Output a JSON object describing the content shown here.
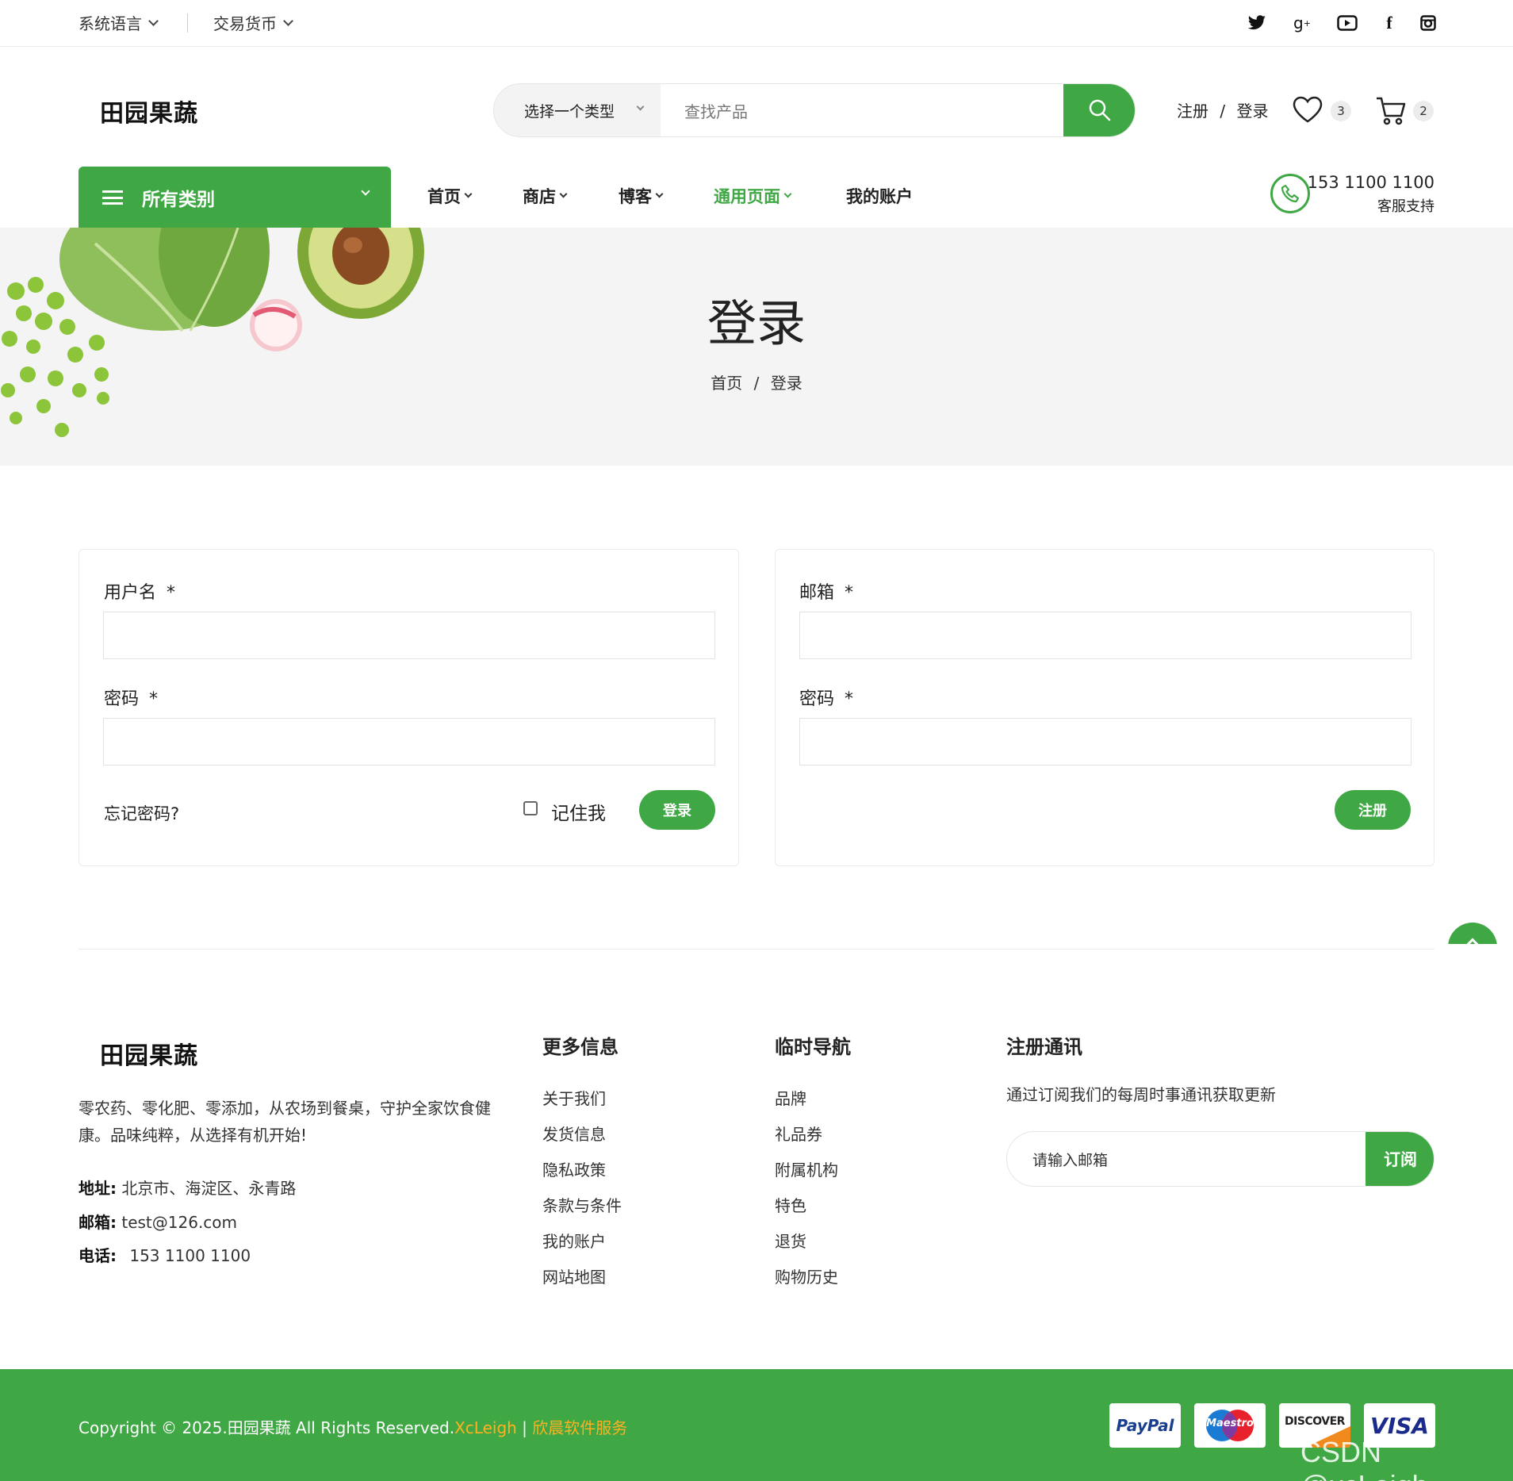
{
  "topbar": {
    "language_label": "系统语言",
    "currency_label": "交易货币",
    "social_icons": [
      "twitter-icon",
      "google-plus-icon",
      "youtube-icon",
      "facebook-icon",
      "instagram-icon"
    ]
  },
  "header": {
    "logo": "田园果蔬",
    "search_category": "选择一个类型",
    "search_placeholder": "查找产品",
    "register": "注册",
    "separator": "/",
    "login": "登录",
    "wishlist_count": "3",
    "cart_count": "2"
  },
  "nav": {
    "all_categories": "所有类别",
    "items": [
      {
        "label": "首页",
        "dropdown": true
      },
      {
        "label": "商店",
        "dropdown": true
      },
      {
        "label": "博客",
        "dropdown": true
      },
      {
        "label": "通用页面",
        "dropdown": true,
        "active": true
      },
      {
        "label": "我的账户",
        "dropdown": false
      }
    ],
    "phone": "153 1100 1100",
    "support_label": "客服支持"
  },
  "banner": {
    "title": "登录",
    "breadcrumb_home": "首页",
    "breadcrumb_sep": "/",
    "breadcrumb_current": "登录"
  },
  "login_form": {
    "username_label": "用户名",
    "password_label": "密码",
    "required_mark": "*",
    "forgot": "忘记密码?",
    "remember": "记住我",
    "submit": "登录"
  },
  "register_form": {
    "email_label": "邮箱",
    "password_label": "密码",
    "required_mark": "*",
    "submit": "注册"
  },
  "footer": {
    "logo": "田园果蔬",
    "about": "零农药、零化肥、零添加，从农场到餐桌，守护全家饮食健康。品味纯粹，从选择有机开始!",
    "address_label": "地址:",
    "address": "北京市、海淀区、永青路",
    "email_label": "邮箱:",
    "email": "test@126.com",
    "phone_label": "电话:",
    "phone": "153 1100 1100",
    "col1_title": "更多信息",
    "col1_links": [
      "关于我们",
      "发货信息",
      "隐私政策",
      "条款与条件",
      "我的账户",
      "网站地图"
    ],
    "col2_title": "临时导航",
    "col2_links": [
      "品牌",
      "礼品券",
      "附属机构",
      "特色",
      "退货",
      "购物历史"
    ],
    "newsletter_title": "注册通讯",
    "newsletter_desc": "通过订阅我们的每周时事通讯获取更新",
    "newsletter_placeholder": "请输入邮箱",
    "newsletter_button": "订阅"
  },
  "bottom": {
    "copyright": "Copyright © 2025.田园果蔬 All Rights Reserved.",
    "author": "XcLeigh",
    "sep": " | ",
    "service": "欣晨软件服务",
    "payments": [
      "PayPal",
      "Maestro",
      "DISCOVER",
      "VISA"
    ],
    "watermark": "CSDN @xcLeigh"
  },
  "colors": {
    "brand_green": "#3fa845",
    "accent_orange": "#ffb020",
    "banner_bg": "#f4f4f4"
  }
}
